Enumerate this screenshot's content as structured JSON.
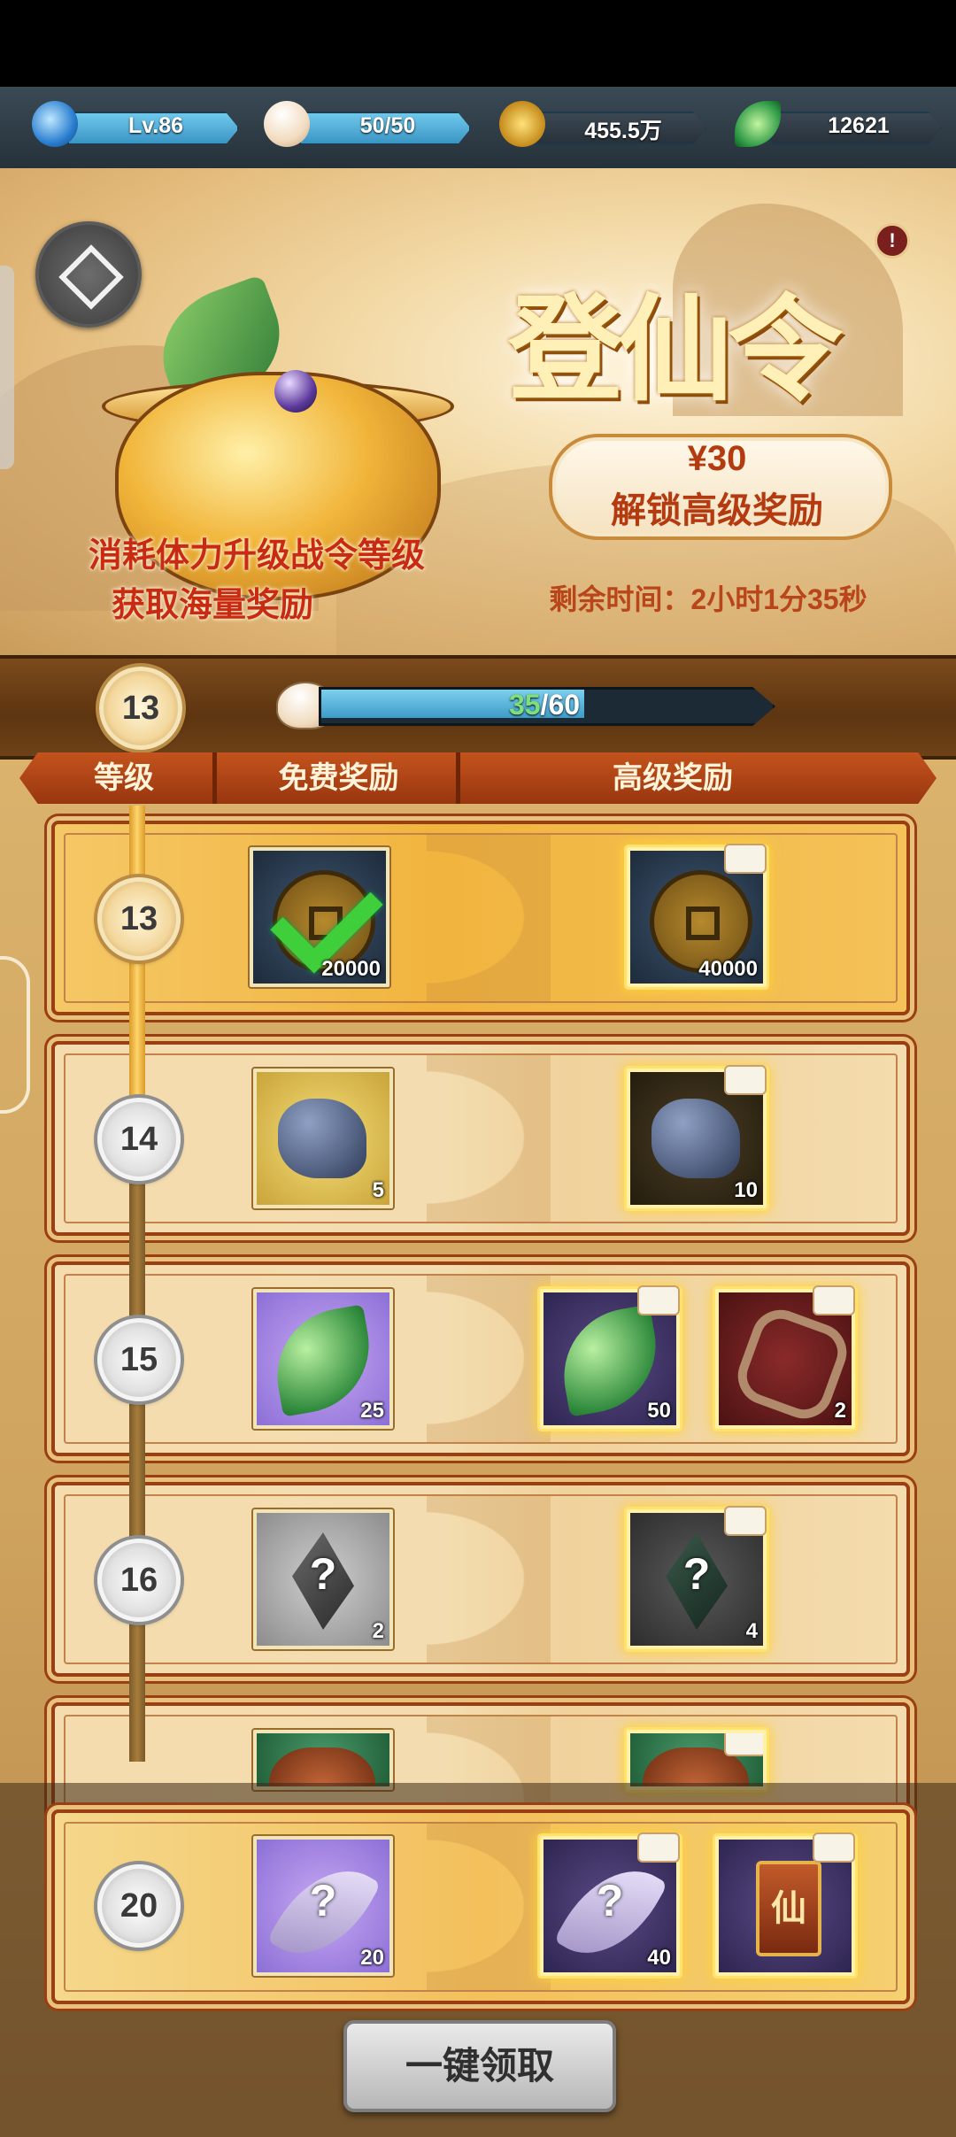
{
  "resources": [
    {
      "name": "level",
      "value": "Lv.86",
      "icon": "swirl-level-icon",
      "color": "#3fa4e0"
    },
    {
      "name": "stamina",
      "value": "50/50",
      "icon": "steamed-bun-icon",
      "color": "#3b95c4"
    },
    {
      "name": "coins",
      "value": "455.5万",
      "icon": "copper-coin-icon",
      "color": "#e2b23a"
    },
    {
      "name": "leaf-currency",
      "value": "12621",
      "icon": "green-leaf-icon",
      "color": "#3fbf6a"
    }
  ],
  "banner": {
    "title": "登仙令",
    "price": "¥30",
    "unlock_text": "解锁高级奖励",
    "slogan_line1": "消耗体力升级战令等级",
    "slogan_line2": "获取海量奖励",
    "timer": "剩余时间：2小时1分35秒",
    "info_badge": "!"
  },
  "progress": {
    "current_level": "13",
    "exp_current": "35",
    "exp_max": "/60",
    "fraction": 0.583
  },
  "columns": {
    "level": "等级",
    "free": "免费奖励",
    "premium": "高级奖励"
  },
  "rows": [
    {
      "level": "13",
      "free": {
        "icon": "copper-coin-icon",
        "count": "20000",
        "claimed": true
      },
      "premium": [
        {
          "icon": "copper-coin-icon",
          "count": "40000",
          "locked": true
        }
      ]
    },
    {
      "level": "14",
      "free": {
        "icon": "ore-rock-icon",
        "count": "5"
      },
      "premium": [
        {
          "icon": "ore-rock-icon",
          "count": "10",
          "locked": true
        }
      ]
    },
    {
      "level": "15",
      "free": {
        "icon": "green-leaf-icon",
        "count": "25"
      },
      "premium": [
        {
          "icon": "green-leaf-icon",
          "count": "50",
          "locked": true
        },
        {
          "icon": "jade-chain-icon",
          "count": "2",
          "locked": true
        }
      ]
    },
    {
      "level": "16",
      "free": {
        "icon": "mystery-shard-icon",
        "count": "2",
        "symbol": "?"
      },
      "premium": [
        {
          "icon": "mystery-shard-icon",
          "count": "4",
          "symbol": "?",
          "locked": true
        }
      ]
    },
    {
      "level": "20",
      "free": {
        "icon": "mystery-feather-icon",
        "count": "20",
        "symbol": "?"
      },
      "premium": [
        {
          "icon": "mystery-feather-icon",
          "count": "40",
          "symbol": "?",
          "locked": true
        },
        {
          "icon": "immortal-token-icon",
          "count": "",
          "symbol": "仙",
          "locked": true
        }
      ]
    }
  ],
  "claim_all_label": "一键领取"
}
